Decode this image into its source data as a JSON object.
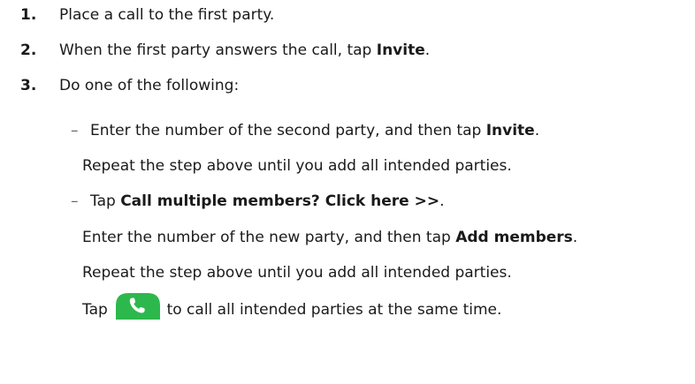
{
  "steps": [
    {
      "number": "1.",
      "text": "Place a call to the first party."
    },
    {
      "number": "2.",
      "text_before": "When the first party answers the call, tap ",
      "bold": "Invite",
      "text_after": "."
    },
    {
      "number": "3.",
      "text": "Do one of the following:"
    }
  ],
  "options": {
    "dash": "–",
    "option1": {
      "text_before": "Enter the number of the second party, and then tap ",
      "bold": "Invite",
      "text_after": ".",
      "repeat": "Repeat the step above until you add all intended parties."
    },
    "option2": {
      "text_before": "Tap ",
      "bold": "Call multiple members? Click here >>",
      "text_after": ".",
      "enter_before": "Enter the number of the new party, and then tap ",
      "enter_bold": "Add members",
      "enter_after": ".",
      "repeat": "Repeat the step above until you add all intended parties.",
      "tap_before": "Tap ",
      "tap_after": " to call all intended parties at the same time."
    }
  },
  "icons": {
    "call_button": "phone-call-icon",
    "call_button_color": "#2db84d"
  }
}
